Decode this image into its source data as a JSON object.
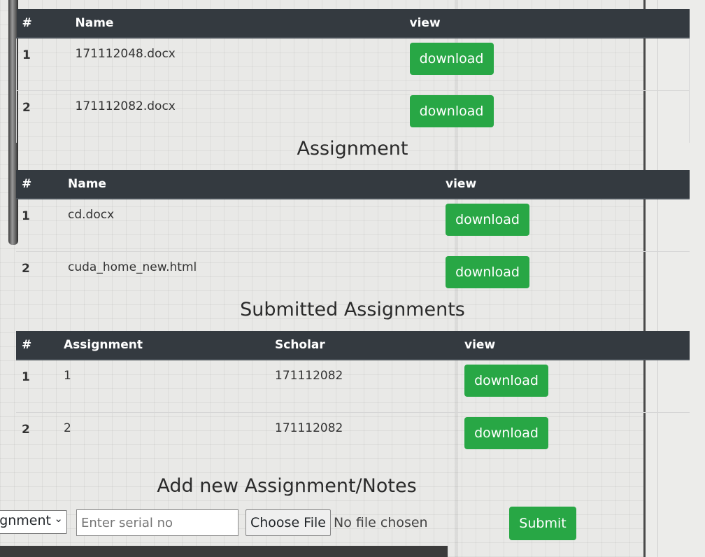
{
  "notes": {
    "headers": [
      "#",
      "Name",
      "view"
    ],
    "rows": [
      {
        "num": "1",
        "name": "171112048.docx",
        "action": "download"
      },
      {
        "num": "2",
        "name": "171112082.docx",
        "action": "download"
      }
    ]
  },
  "assignment": {
    "title": "Assignment",
    "headers": [
      "#",
      "Name",
      "view"
    ],
    "rows": [
      {
        "num": "1",
        "name": "cd.docx",
        "action": "download"
      },
      {
        "num": "2",
        "name": "cuda_home_new.html",
        "action": "download"
      }
    ]
  },
  "submitted": {
    "title": "Submitted Assignments",
    "headers": [
      "#",
      "Assignment",
      "Scholar",
      "view"
    ],
    "rows": [
      {
        "num": "1",
        "assignment": "1",
        "scholar": "171112082",
        "action": "download"
      },
      {
        "num": "2",
        "assignment": "2",
        "scholar": "171112082",
        "action": "download"
      }
    ]
  },
  "add_form": {
    "title": "Add new Assignment/Notes",
    "type_select_value": "Assignment",
    "serial_placeholder": "Enter serial no",
    "choose_file_label": "Choose File",
    "no_file_text": "No file chosen",
    "submit_label": "Submit"
  },
  "colors": {
    "header_bg": "#343a40",
    "button_green": "#28a745"
  }
}
